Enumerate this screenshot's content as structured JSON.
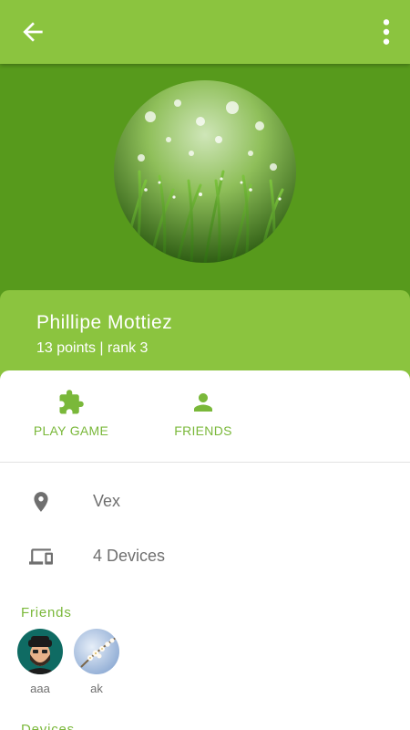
{
  "toolbar": {
    "back_icon": "arrow-back-icon",
    "menu_icon": "more-vert-icon",
    "color": "#8bc43f"
  },
  "profile": {
    "name": "Phillipe Mottiez",
    "stats": "13 points | rank 3",
    "avatar": "grass-photo"
  },
  "actions": [
    {
      "label": "PLAY GAME",
      "icon": "puzzle-icon"
    },
    {
      "label": "FRIENDS",
      "icon": "person-icon"
    }
  ],
  "info": {
    "location": "Vex",
    "devices": "4 Devices"
  },
  "friends_section": {
    "title": "Friends",
    "items": [
      {
        "name": "aaa",
        "avatar": "bearded-man-cartoon"
      },
      {
        "name": "ak",
        "avatar": "blossom-photo"
      }
    ]
  },
  "devices_section": {
    "title": "Devices"
  },
  "colors": {
    "accent": "#8bc43f",
    "hero": "#579a1c",
    "text_secondary": "#6f6f6f"
  }
}
